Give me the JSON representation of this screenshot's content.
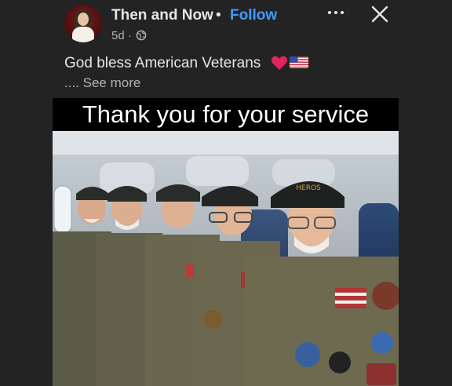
{
  "post": {
    "page_name": "Then and Now",
    "separator": "•",
    "follow_label": "Follow",
    "time": "5d ·",
    "text": "God bless American Veterans",
    "see_more": ".... See more",
    "banner_text": "Thank you for your service",
    "cap_text": "HEROS"
  },
  "icons": {
    "avatar": "avatar-photo",
    "privacy": "globe-icon",
    "more": "more-dots-icon",
    "close": "close-icon",
    "heart": "red-heart-icon",
    "flag": "us-flag-icon"
  },
  "colors": {
    "background": "#232323",
    "link": "#4599ff",
    "heart": "#e0245e"
  }
}
